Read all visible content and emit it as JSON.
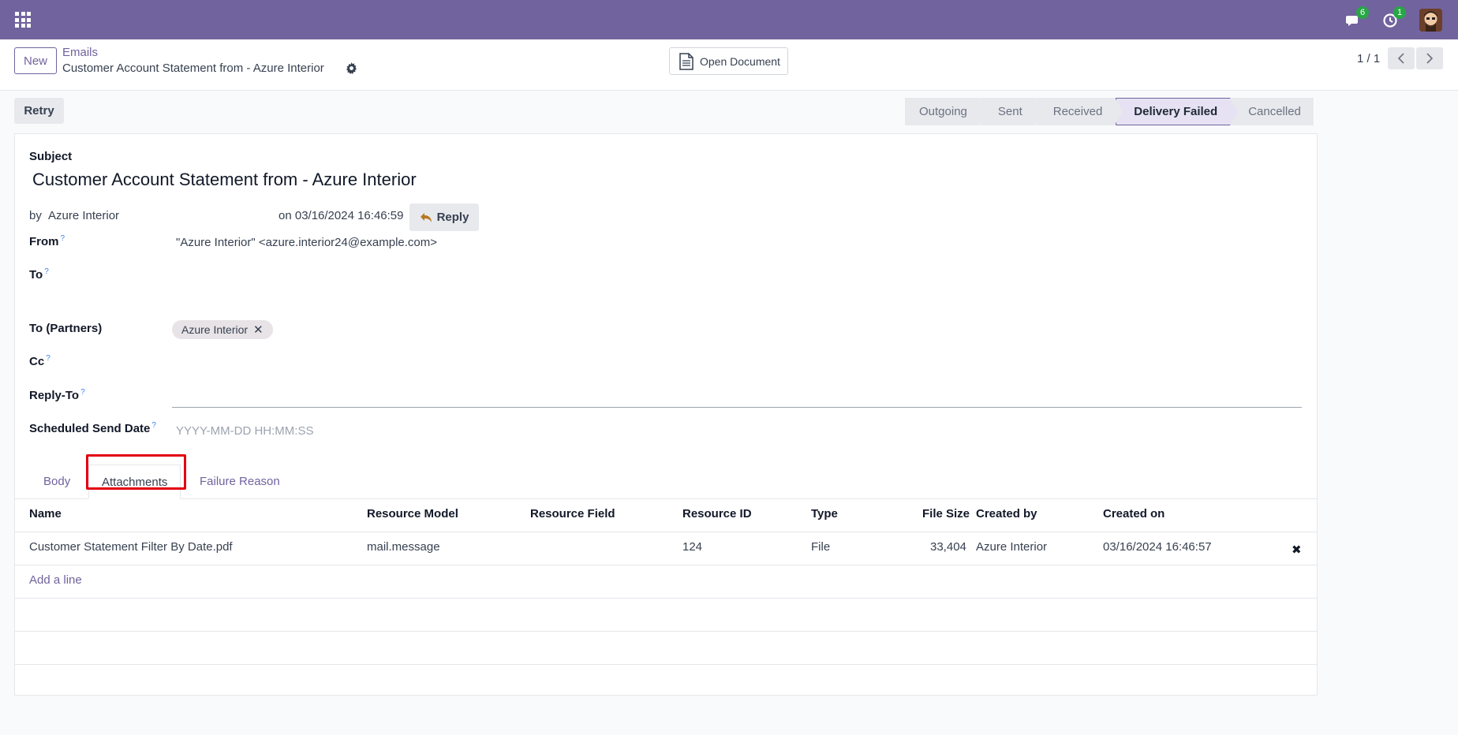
{
  "topbar": {
    "messages_badge": "6",
    "activities_badge": "1"
  },
  "control_panel": {
    "new_label": "New",
    "breadcrumb_parent": "Emails",
    "breadcrumb_current": "Customer Account Statement from - Azure Interior",
    "open_document_label": "Open Document",
    "pager_value": "1 / 1"
  },
  "statusbar": {
    "retry_label": "Retry",
    "stages": [
      "Outgoing",
      "Sent",
      "Received",
      "Delivery Failed",
      "Cancelled"
    ],
    "active_stage": "Delivery Failed"
  },
  "form": {
    "subject_label": "Subject",
    "subject_value": "Customer Account Statement from  - Azure Interior",
    "by_prefix": "by",
    "author": "Azure Interior",
    "date_text": "on 03/16/2024 16:46:59",
    "reply_label": "Reply",
    "from_label": "From",
    "from_value": "\"Azure Interior\" <azure.interior24@example.com>",
    "to_label": "To",
    "to_partners_label": "To (Partners)",
    "to_partners_tag": "Azure Interior",
    "cc_label": "Cc",
    "reply_to_label": "Reply-To",
    "scheduled_label": "Scheduled Send Date",
    "scheduled_placeholder": "YYYY-MM-DD HH:MM:SS",
    "help_mark": "?"
  },
  "tabs": [
    "Body",
    "Attachments",
    "Failure Reason"
  ],
  "attachments_table": {
    "headers": [
      "Name",
      "Resource Model",
      "Resource Field",
      "Resource ID",
      "Type",
      "File Size",
      "Created by",
      "Created on"
    ],
    "rows": [
      {
        "name": "Customer Statement Filter By Date.pdf",
        "resource_model": "mail.message",
        "resource_field": "",
        "resource_id": "124",
        "type": "File",
        "file_size": "33,404",
        "created_by": "Azure Interior",
        "created_on": "03/16/2024 16:46:57"
      }
    ],
    "add_line_label": "Add a line"
  },
  "colors": {
    "brand": "#71639e",
    "highlight": "#e3000f"
  }
}
